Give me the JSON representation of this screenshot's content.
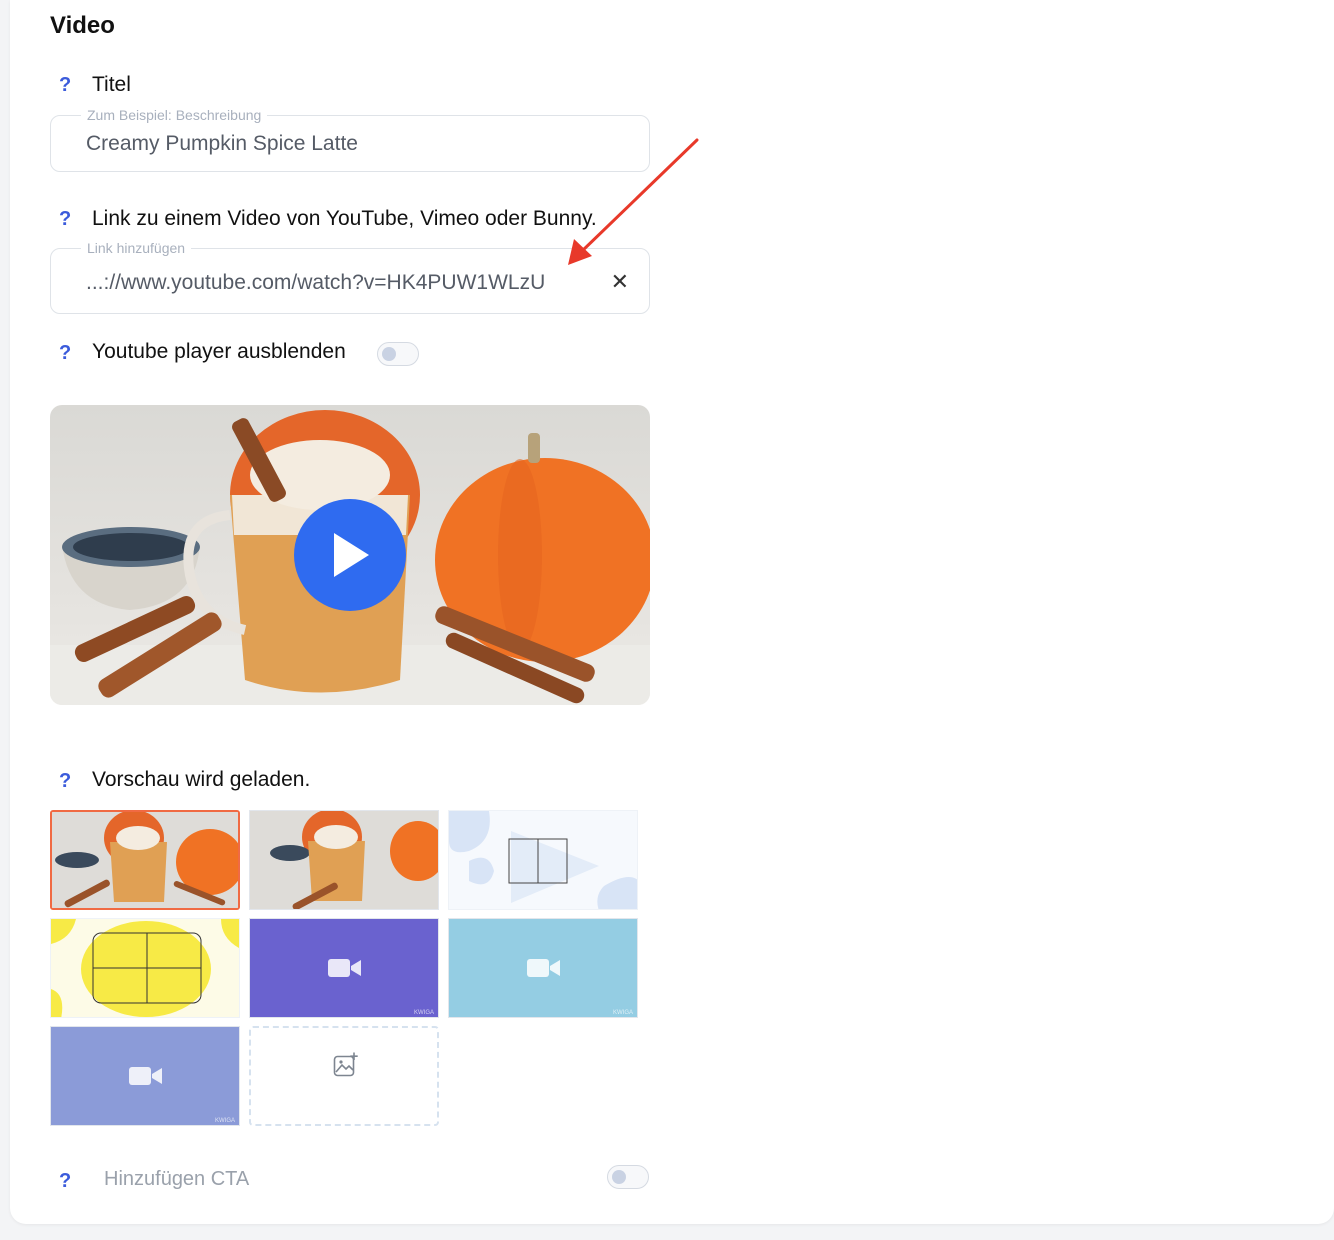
{
  "section": {
    "title": "Video"
  },
  "help_glyph": "?",
  "title_field": {
    "label": "Titel",
    "legend": "Zum Beispiel: Beschreibung",
    "value": "Creamy Pumpkin Spice Latte"
  },
  "link_field": {
    "label": "Link zu einem Video von YouTube, Vimeo oder Bunny.",
    "legend": "Link hinzufügen",
    "value": "...://www.youtube.com/watch?v=HK4PUW1WLzU",
    "clear_glyph": "✕"
  },
  "hide_player": {
    "label": "Youtube player ausblenden",
    "enabled": false
  },
  "preview": {
    "label": "Vorschau wird geladen."
  },
  "thumbnails": {
    "watermark": "KWIGA",
    "colors": [
      "#6a62cf",
      "#94cde3",
      "#8b9bd8"
    ]
  },
  "cta": {
    "label": "Hinzufügen CTA",
    "enabled": false
  },
  "colors": {
    "accent": "#3b5bdb",
    "play": "#2f6bf0",
    "selected": "#f06a43",
    "arrow": "#e8392a"
  }
}
